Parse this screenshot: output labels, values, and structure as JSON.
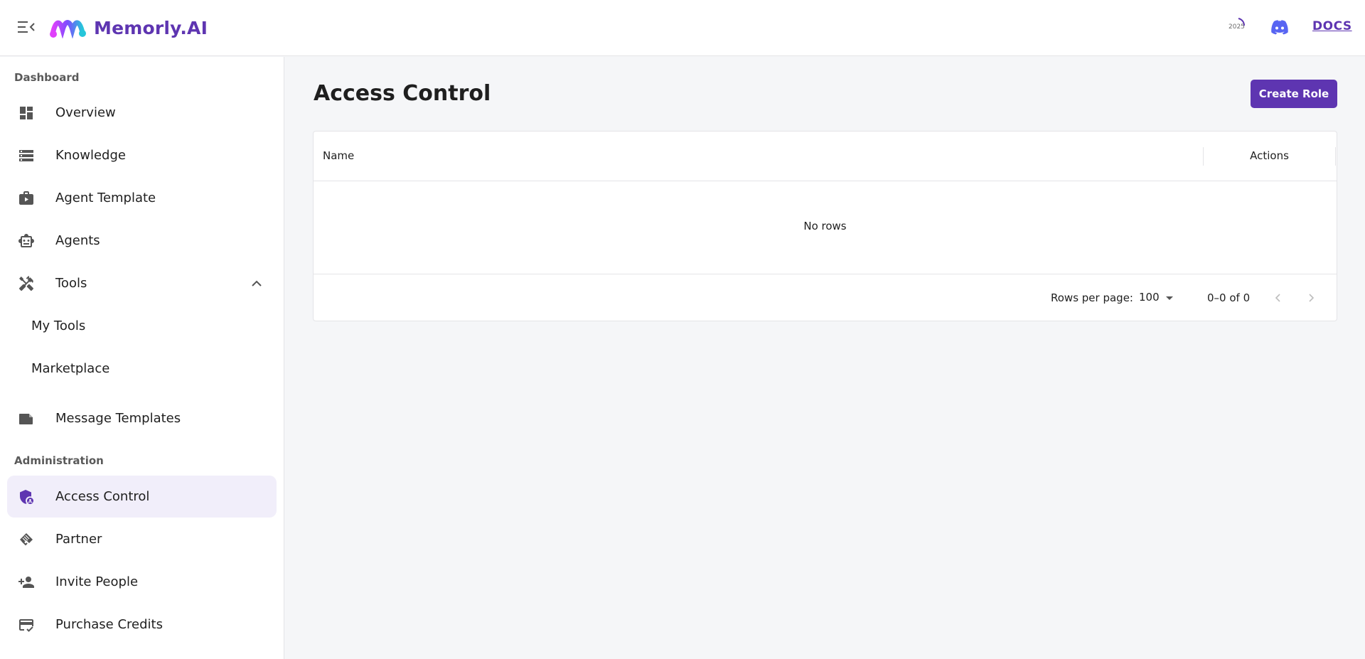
{
  "header": {
    "app_name": "Memorly.AI",
    "year_badge": "2025",
    "docs_label": "DOCS",
    "brand_color": "#5e35b1"
  },
  "sidebar": {
    "sections": [
      {
        "label": "Dashboard"
      },
      {
        "label": "Administration"
      }
    ],
    "items": [
      {
        "label": "Overview",
        "icon": "dashboard-icon"
      },
      {
        "label": "Knowledge",
        "icon": "storage-icon"
      },
      {
        "label": "Agent Template",
        "icon": "template-icon"
      },
      {
        "label": "Agents",
        "icon": "robot-icon"
      },
      {
        "label": "Tools",
        "icon": "tools-icon",
        "expanded": true
      },
      {
        "label": "My Tools"
      },
      {
        "label": "Marketplace"
      },
      {
        "label": "Message Templates",
        "icon": "label-icon"
      },
      {
        "label": "Access Control",
        "icon": "admin-shield-icon",
        "active": true
      },
      {
        "label": "Partner",
        "icon": "handshake-icon"
      },
      {
        "label": "Invite People",
        "icon": "person-add-icon"
      },
      {
        "label": "Purchase Credits",
        "icon": "credit-card-icon"
      }
    ]
  },
  "main": {
    "title": "Access Control",
    "create_button": "Create Role",
    "table": {
      "columns": [
        "Name",
        "Actions"
      ],
      "empty_text": "No rows",
      "rows_per_page_label": "Rows per page:",
      "rows_per_page": "100",
      "range_text": "0–0 of 0"
    }
  }
}
